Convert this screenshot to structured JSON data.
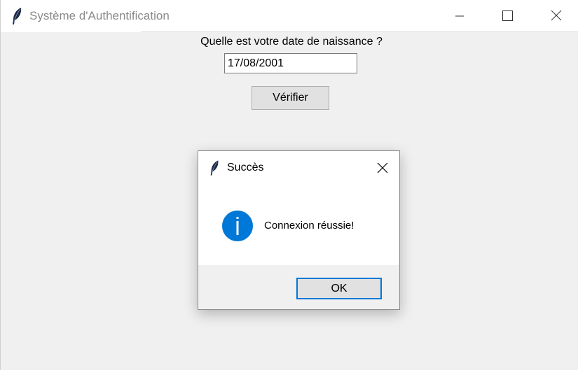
{
  "window": {
    "title": "Système d'Authentification"
  },
  "form": {
    "prompt": "Quelle est votre date de naissance ?",
    "date_value": "17/08/2001",
    "verify_label": "Vérifier"
  },
  "dialog": {
    "title": "Succès",
    "message": "Connexion réussie!",
    "ok_label": "OK",
    "icon": "info-icon"
  },
  "colors": {
    "info_blue": "#0078d7",
    "window_bg": "#f0f0f0",
    "focus_border": "#0078d7"
  }
}
